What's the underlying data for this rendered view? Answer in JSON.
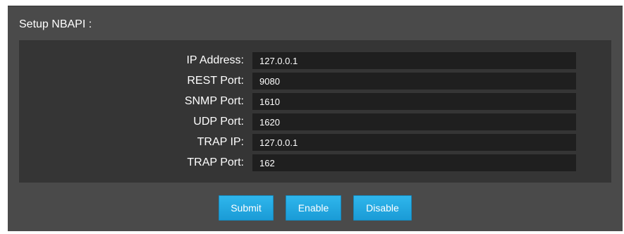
{
  "panel": {
    "title": "Setup NBAPI :"
  },
  "fields": [
    {
      "label": "IP Address:",
      "value": "127.0.0.1"
    },
    {
      "label": "REST Port:",
      "value": "9080"
    },
    {
      "label": "SNMP Port:",
      "value": "1610"
    },
    {
      "label": "UDP Port:",
      "value": "1620"
    },
    {
      "label": "TRAP IP:",
      "value": "127.0.0.1"
    },
    {
      "label": "TRAP Port:",
      "value": "162"
    }
  ],
  "buttons": {
    "submit": "Submit",
    "enable": "Enable",
    "disable": "Disable"
  },
  "colors": {
    "accent": "#1fa6e0",
    "panel": "#4a4a4a",
    "form": "#353535",
    "input": "#1f1f1f"
  }
}
